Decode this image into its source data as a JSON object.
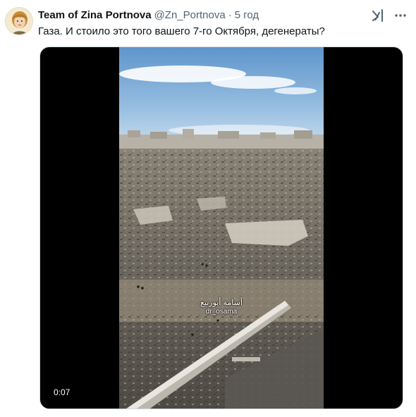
{
  "tweet": {
    "author_name": "Team of Zina Portnova",
    "author_handle": "@Zn_Portnova",
    "separator": "·",
    "timestamp": "5 год",
    "text": "Газа. И стоило это того вашего 7-го Октября, дегенераты?"
  },
  "media": {
    "timecode": "0:07",
    "watermark_arabic": "أسامة أبوربيع",
    "watermark_handle": "dr_osama"
  },
  "icons": {
    "avatar": "avatar-portrait",
    "grok": "grok-icon",
    "more": "more-options-icon"
  },
  "colors": {
    "text_primary": "#0f1419",
    "text_secondary": "#536471",
    "media_background": "#000000",
    "sky": "#6f9ccf"
  }
}
